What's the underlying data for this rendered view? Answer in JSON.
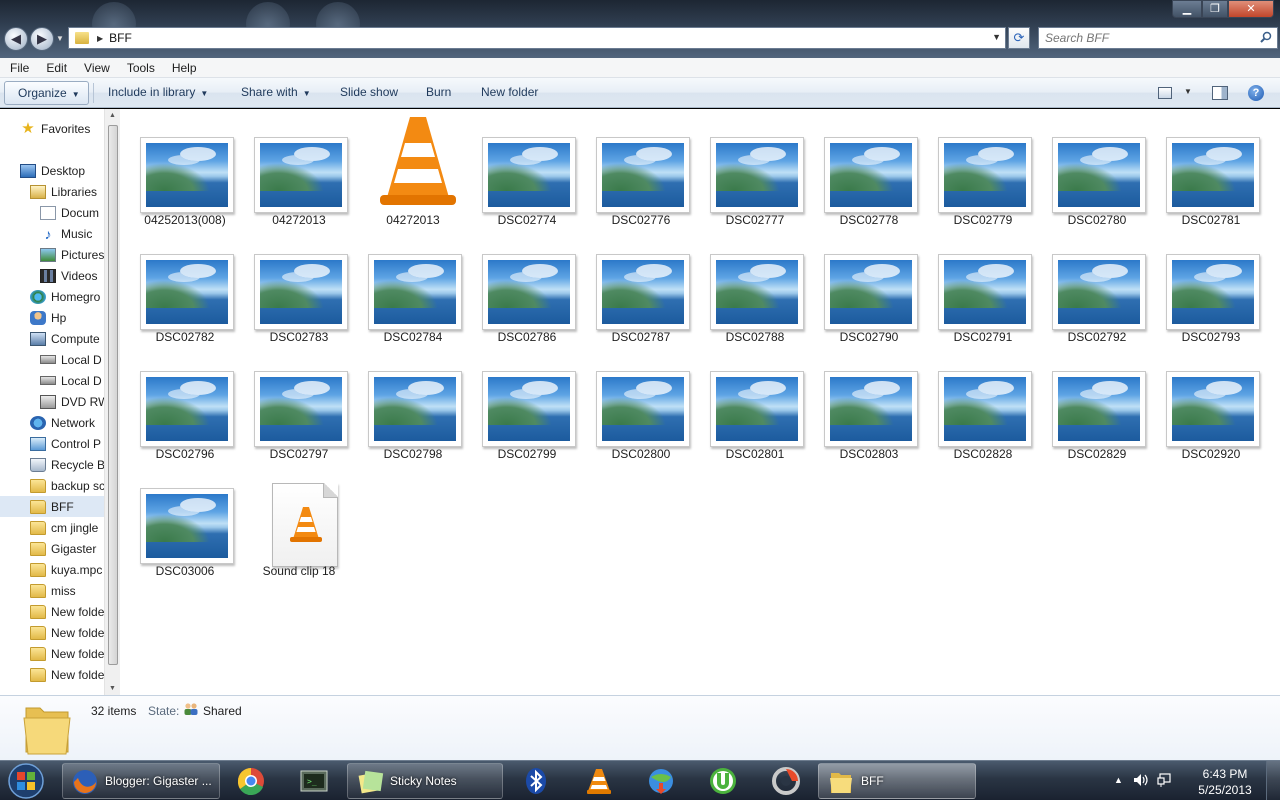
{
  "window": {
    "breadcrumb": "BFF",
    "search_placeholder": "Search BFF"
  },
  "menubar": [
    "File",
    "Edit",
    "View",
    "Tools",
    "Help"
  ],
  "commandbar": {
    "organize": "Organize",
    "include_in_library": "Include in library",
    "share_with": "Share with",
    "slide_show": "Slide show",
    "burn": "Burn",
    "new_folder": "New folder"
  },
  "navpane": [
    {
      "label": "Favorites",
      "icon": "star-icon"
    },
    {
      "label": "Desktop",
      "icon": "desktop-icon"
    },
    {
      "label": "Libraries",
      "icon": "libraries-icon"
    },
    {
      "label": "Docum",
      "icon": "documents-icon"
    },
    {
      "label": "Music",
      "icon": "music-icon"
    },
    {
      "label": "Pictures",
      "icon": "pictures-icon"
    },
    {
      "label": "Videos",
      "icon": "videos-icon"
    },
    {
      "label": "Homegro",
      "icon": "homegroup-icon"
    },
    {
      "label": "Hp",
      "icon": "user-icon"
    },
    {
      "label": "Compute",
      "icon": "computer-icon"
    },
    {
      "label": "Local D",
      "icon": "drive-icon"
    },
    {
      "label": "Local D",
      "icon": "drive-icon"
    },
    {
      "label": "DVD RW",
      "icon": "dvd-icon"
    },
    {
      "label": "Network",
      "icon": "network-icon"
    },
    {
      "label": "Control P",
      "icon": "control-panel-icon"
    },
    {
      "label": "Recycle B",
      "icon": "recycle-bin-icon"
    },
    {
      "label": "backup sc",
      "icon": "folder-icon"
    },
    {
      "label": "BFF",
      "icon": "folder-icon",
      "selected": true
    },
    {
      "label": "cm jingle",
      "icon": "folder-icon"
    },
    {
      "label": "Gigaster",
      "icon": "folder-icon"
    },
    {
      "label": "kuya.mpc",
      "icon": "folder-icon"
    },
    {
      "label": "miss",
      "icon": "folder-icon"
    },
    {
      "label": "New folde",
      "icon": "folder-icon"
    },
    {
      "label": "New folde",
      "icon": "folder-icon"
    },
    {
      "label": "New folde",
      "icon": "folder-icon"
    },
    {
      "label": "New folde",
      "icon": "folder-icon"
    }
  ],
  "files": [
    {
      "name": "04252013(008)",
      "type": "image"
    },
    {
      "name": "04272013",
      "type": "image"
    },
    {
      "name": "04272013",
      "type": "vlc"
    },
    {
      "name": "DSC02774",
      "type": "image"
    },
    {
      "name": "DSC02776",
      "type": "image"
    },
    {
      "name": "DSC02777",
      "type": "image"
    },
    {
      "name": "DSC02778",
      "type": "image"
    },
    {
      "name": "DSC02779",
      "type": "image"
    },
    {
      "name": "DSC02780",
      "type": "image"
    },
    {
      "name": "DSC02781",
      "type": "image"
    },
    {
      "name": "DSC02782",
      "type": "image"
    },
    {
      "name": "DSC02783",
      "type": "image"
    },
    {
      "name": "DSC02784",
      "type": "image"
    },
    {
      "name": "DSC02786",
      "type": "image"
    },
    {
      "name": "DSC02787",
      "type": "image"
    },
    {
      "name": "DSC02788",
      "type": "image"
    },
    {
      "name": "DSC02790",
      "type": "image"
    },
    {
      "name": "DSC02791",
      "type": "image"
    },
    {
      "name": "DSC02792",
      "type": "image"
    },
    {
      "name": "DSC02793",
      "type": "image"
    },
    {
      "name": "DSC02796",
      "type": "image"
    },
    {
      "name": "DSC02797",
      "type": "image"
    },
    {
      "name": "DSC02798",
      "type": "image"
    },
    {
      "name": "DSC02799",
      "type": "image"
    },
    {
      "name": "DSC02800",
      "type": "image"
    },
    {
      "name": "DSC02801",
      "type": "image"
    },
    {
      "name": "DSC02803",
      "type": "image"
    },
    {
      "name": "DSC02828",
      "type": "image"
    },
    {
      "name": "DSC02829",
      "type": "image"
    },
    {
      "name": "DSC02920",
      "type": "image"
    },
    {
      "name": "DSC03006",
      "type": "image"
    },
    {
      "name": "Sound clip 18",
      "type": "sound"
    }
  ],
  "details": {
    "count": "32 items",
    "state_label": "State:",
    "state_value": "Shared"
  },
  "taskbar": {
    "buttons": [
      {
        "label": "Blogger: Gigaster ...",
        "icon": "firefox-icon"
      },
      {
        "label": "Sticky Notes",
        "icon": "sticky-notes-icon"
      },
      {
        "label": "BFF",
        "icon": "explorer-folder-icon"
      }
    ],
    "pinned": [
      "chrome-icon",
      "terminal-icon",
      "bluetooth-icon",
      "vlc-icon",
      "globe-download-icon",
      "utorrent-icon",
      "camera-aperture-icon"
    ],
    "clock_time": "6:43 PM",
    "clock_date": "5/25/2013"
  },
  "colors": {
    "selection": "#dde8f5",
    "command_bar_text": "#1e395b",
    "taskbar": "#2a3544"
  }
}
